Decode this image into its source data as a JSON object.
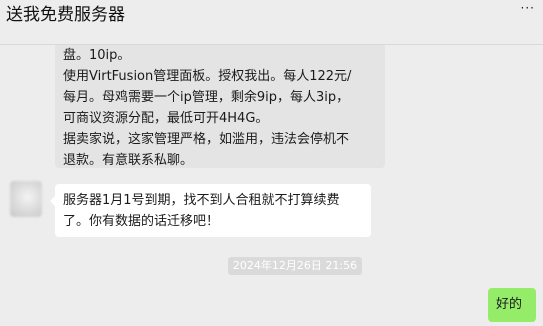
{
  "header": {
    "title": "送我免费服务器",
    "more_label": "···"
  },
  "messages": {
    "gray_bubble": {
      "lines": [
        "盘。10ip。",
        "使用VirtFusion管理面板。授权我出。每人122元/",
        "每月。母鸡需要一个ip管理，剩余9ip，每人3ip，",
        "可商议资源分配，最低可开4H4G。",
        "据卖家说，这家管理严格，如滥用，违法会停机不",
        "退款。有意联系私聊。"
      ]
    },
    "white_bubble": {
      "lines": [
        "服务器1月1号到期，找不到人合租就不打算续费",
        "了。你有数据的话迁移吧！"
      ]
    },
    "timestamp": "2024年12月26日 21:56",
    "green_bubble": {
      "text": "好的"
    }
  },
  "colors": {
    "background": "#ededed",
    "self_bubble": "#95ec69",
    "other_bubble": "#ffffff",
    "quoted_bubble": "#e4e4e4"
  }
}
